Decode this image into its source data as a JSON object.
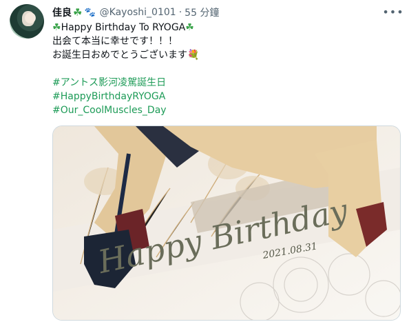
{
  "author": {
    "name": "佳良",
    "handle": "@Kayoshi_0101",
    "separator": "·",
    "time": "55 分鐘",
    "name_emojis": [
      "clover-icon",
      "paw-icon"
    ]
  },
  "more_icon": "more-horizontal-icon",
  "body": {
    "line1": "Happy Birthday To RYOGA",
    "line2": "出会て本当に幸せです！！！",
    "line3": "お誕生日おめでとうございます",
    "hashtags": [
      "#アントス影河凌駕誕生日",
      "#HappyBirthdayRYOGA",
      "#Our_CoolMuscles_Day"
    ]
  },
  "media": {
    "art_text_main": "Happy Birthday",
    "art_text_date": "2021.08.31"
  },
  "colors": {
    "hashtag": "#1d9b57",
    "muted": "#536471",
    "border": "#cfd9de"
  }
}
